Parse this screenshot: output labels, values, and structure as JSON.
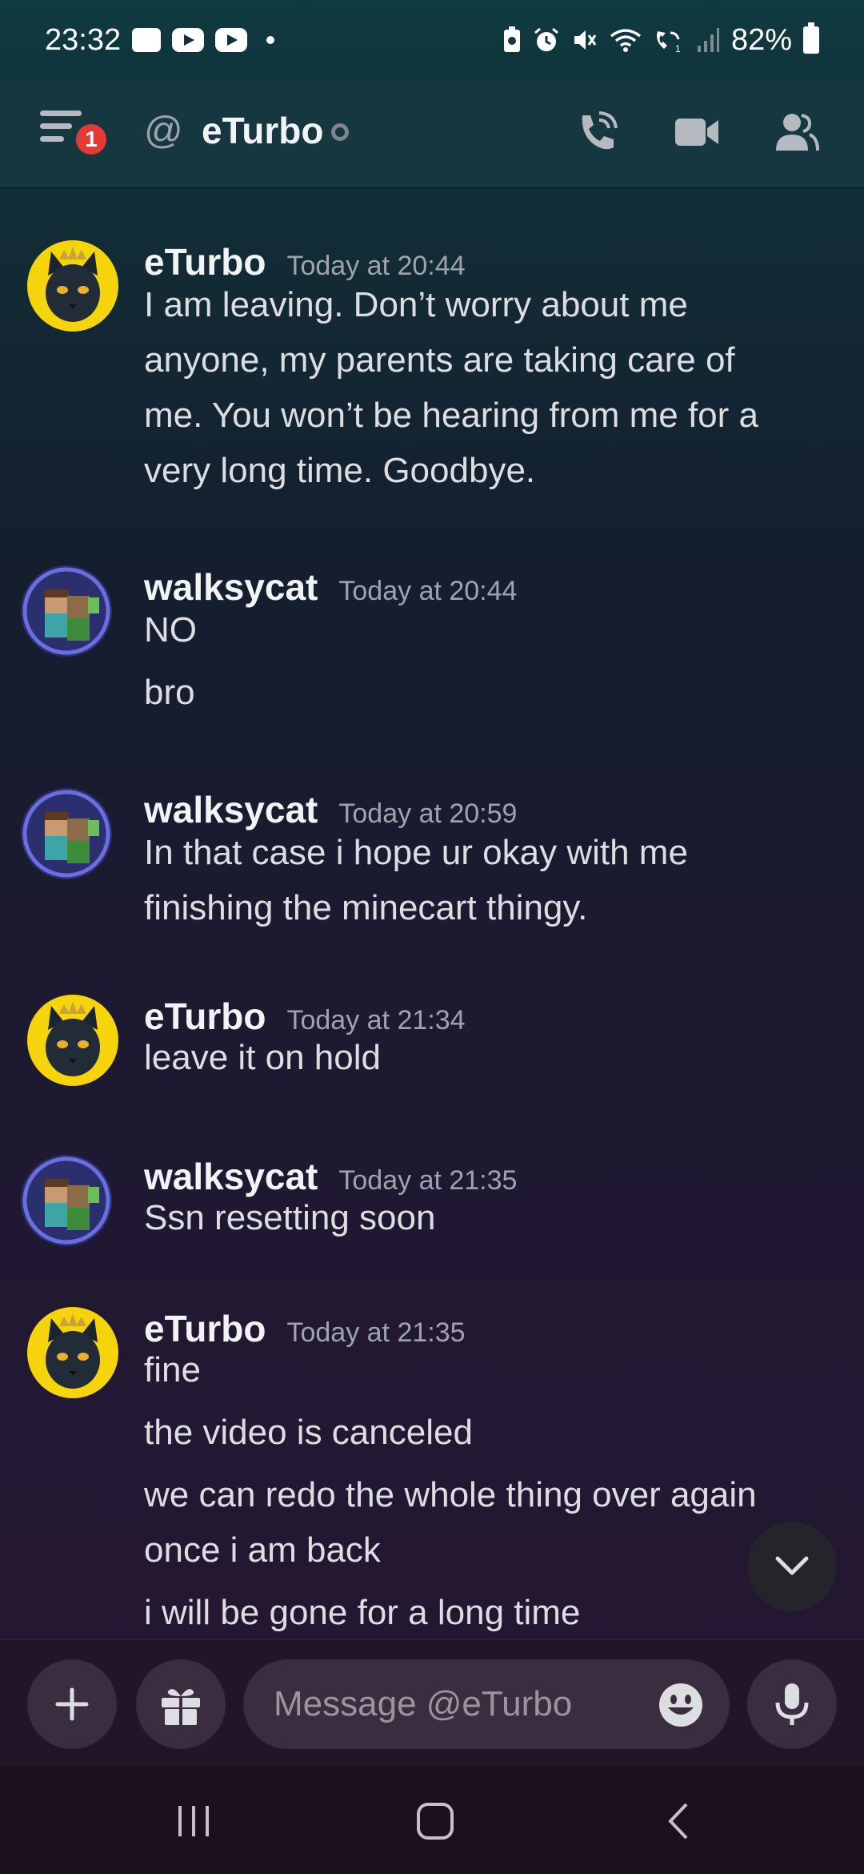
{
  "status_bar": {
    "time": "23:32",
    "battery": "82%",
    "icons": [
      "gallery-icon",
      "youtube-icon",
      "youtube-icon",
      "dot-icon",
      "battery-saver-icon",
      "alarm-icon",
      "mute-icon",
      "wifi-icon",
      "wifi-call-icon",
      "signal-icon",
      "battery-icon"
    ]
  },
  "header": {
    "title": "eTurbo",
    "notification_count": "1",
    "at_symbol": "@",
    "buttons": [
      "call-icon",
      "video-icon",
      "members-icon"
    ]
  },
  "messages": [
    {
      "author": "eTurbo",
      "timestamp": "Today at 20:44",
      "lines": [
        "I am leaving. Don’t worry about me",
        "anyone, my parents are taking care of",
        "me. You won’t be hearing from me for a",
        "very long time. Goodbye."
      ]
    },
    {
      "author": "walksycat",
      "timestamp": "Today at 20:44",
      "lines": [
        "NO",
        "bro"
      ]
    },
    {
      "author": "walksycat",
      "timestamp": "Today at 20:59",
      "lines": [
        "In that case i hope ur okay with me",
        "finishing the minecart thingy."
      ]
    },
    {
      "author": "eTurbo",
      "timestamp": "Today at 21:34",
      "lines": [
        "leave it on hold"
      ]
    },
    {
      "author": "walksycat",
      "timestamp": "Today at 21:35",
      "lines": [
        "Ssn resetting soon"
      ]
    },
    {
      "author": "eTurbo",
      "timestamp": "Today at 21:35",
      "lines": [
        "fine",
        "the video is canceled",
        "we can redo the whole thing over again",
        "once i am back",
        "i will be gone for a long time"
      ]
    }
  ],
  "composer": {
    "placeholder": "Message @eTurbo"
  },
  "colors": {
    "header_bg": "#163740",
    "badge": "#e53935",
    "composer_button": "#392d3f",
    "avatar_cat_bg": "#f5d40c"
  }
}
